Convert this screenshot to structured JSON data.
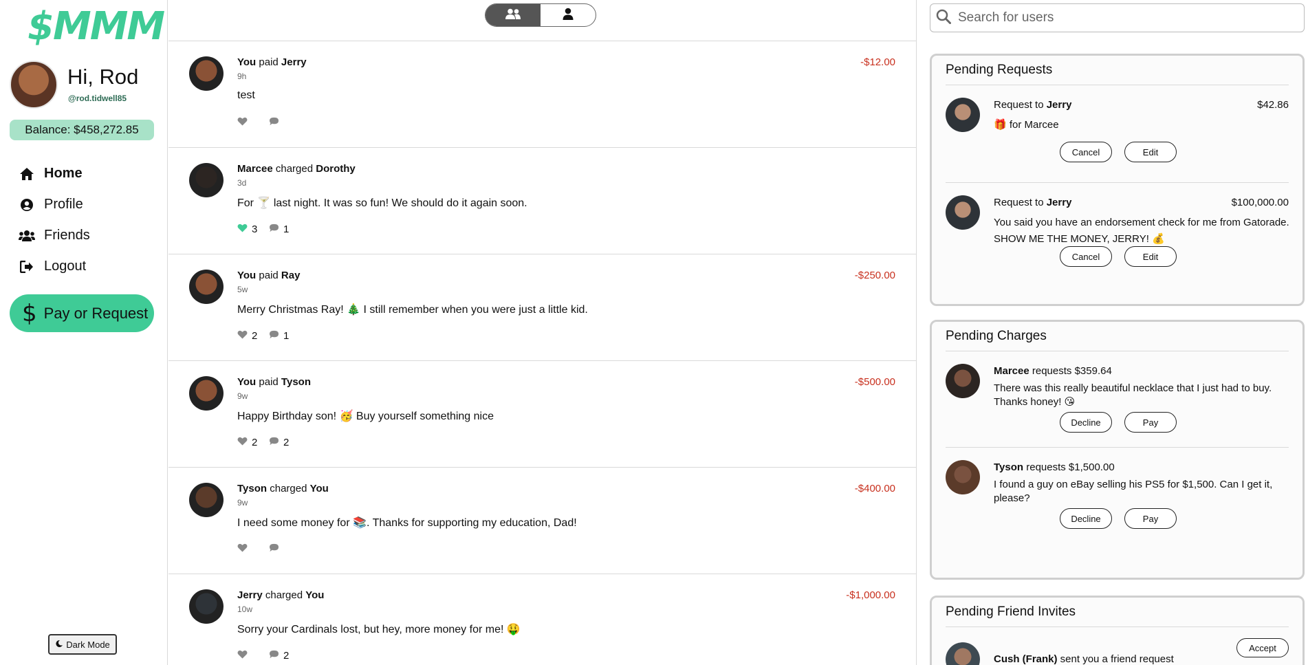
{
  "app": {
    "logo": "$MMM"
  },
  "user": {
    "greeting": "Hi, Rod",
    "handle": "@rod.tidwell85",
    "balance": "Balance: $458,272.85"
  },
  "nav": [
    {
      "label": "Home",
      "icon": "home-icon",
      "active": true
    },
    {
      "label": "Profile",
      "icon": "user-circle-icon",
      "active": false
    },
    {
      "label": "Friends",
      "icon": "users-icon",
      "active": false
    },
    {
      "label": "Logout",
      "icon": "logout-icon",
      "active": false
    }
  ],
  "pay_button": {
    "label": "Pay or Request",
    "icon": "dollar-icon"
  },
  "dark_mode": {
    "label": "Dark Mode",
    "icon": "moon-icon"
  },
  "feed_toggle": {
    "options": [
      "friends-icon",
      "person-icon"
    ],
    "active": 0
  },
  "feed": [
    {
      "actor": "You",
      "verb": " paid ",
      "target": "Jerry",
      "time": "9h",
      "amount": "-$12.00",
      "message": "test",
      "likes": "",
      "comments": "",
      "liked": false,
      "avatar_color": "#8a5236"
    },
    {
      "actor": "Marcee",
      "verb": " charged ",
      "target": "Dorothy",
      "time": "3d",
      "amount": "",
      "message": "For 🍸 last night. It was so fun! We should do it again soon.",
      "likes": "3",
      "comments": "1",
      "liked": true,
      "avatar_color": "#2c2522"
    },
    {
      "actor": "You",
      "verb": " paid ",
      "target": "Ray",
      "time": "5w",
      "amount": "-$250.00",
      "message": "Merry Christmas Ray! 🎄 I still remember when you were just a little kid.",
      "likes": "2",
      "comments": "1",
      "liked": false,
      "avatar_color": "#8a5236"
    },
    {
      "actor": "You",
      "verb": " paid ",
      "target": "Tyson",
      "time": "9w",
      "amount": "-$500.00",
      "message": "Happy Birthday son! 🥳 Buy yourself something nice",
      "likes": "2",
      "comments": "2",
      "liked": false,
      "avatar_color": "#8a5236"
    },
    {
      "actor": "Tyson",
      "verb": " charged ",
      "target": "You",
      "time": "9w",
      "amount": "-$400.00",
      "message": "I need some money for 📚. Thanks for supporting my education, Dad!",
      "likes": "",
      "comments": "",
      "liked": false,
      "avatar_color": "#5b3b2a"
    },
    {
      "actor": "Jerry",
      "verb": " charged ",
      "target": "You",
      "time": "10w",
      "amount": "-$1,000.00",
      "message": "Sorry your Cardinals lost, but hey, more money for me! 🤑",
      "likes": "",
      "comments": "2",
      "liked": false,
      "avatar_color": "#2e3338"
    }
  ],
  "search": {
    "placeholder": "Search for users"
  },
  "pending_requests": {
    "title": "Pending Requests",
    "items": [
      {
        "prefix": "Request to ",
        "name": "Jerry",
        "amount": "$42.86",
        "text": "🎁 for Marcee",
        "btn1": "Cancel",
        "btn2": "Edit",
        "avatar_color": "#2e3338"
      },
      {
        "prefix": "Request to ",
        "name": "Jerry",
        "amount": "$100,000.00",
        "text": "You said you have an endorsement check for me from Gatorade. SHOW ME THE MONEY, JERRY! 💰",
        "btn1": "Cancel",
        "btn2": "Edit",
        "avatar_color": "#2e3338"
      }
    ]
  },
  "pending_charges": {
    "title": "Pending Charges",
    "items": [
      {
        "name": "Marcee",
        "suffix": " requests $359.64",
        "text": "There was this really beautiful necklace that I just had to buy. Thanks honey! 😘",
        "btn1": "Decline",
        "btn2": "Pay",
        "avatar_color": "#2c2522"
      },
      {
        "name": "Tyson",
        "suffix": " requests $1,500.00",
        "text": "I found a guy on eBay selling his PS5 for $1,500. Can I get it, please?",
        "btn1": "Decline",
        "btn2": "Pay",
        "avatar_color": "#5b3b2a"
      }
    ]
  },
  "pending_invites": {
    "title": "Pending Friend Invites",
    "items": [
      {
        "name": "Cush (Frank)",
        "suffix": " sent you a friend request",
        "btn": "Accept",
        "avatar_color": "#3e4a52"
      }
    ]
  }
}
